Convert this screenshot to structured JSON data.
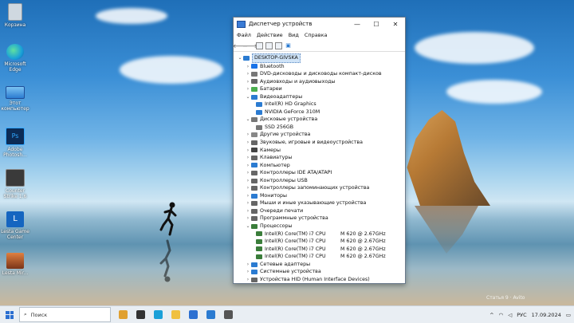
{
  "desktop": {
    "icons": [
      {
        "label": "Корзина",
        "icon": "recycle-bin-icon",
        "color": "#cfd8e0"
      },
      {
        "label": "Microsoft Edge",
        "icon": "edge-icon",
        "color": "#1aa0d8"
      },
      {
        "label": "Этот компьютер",
        "icon": "computer-icon",
        "color": "#4aa3e0"
      },
      {
        "label": "Adobe Photosh...",
        "icon": "photoshop-icon",
        "color": "#0c2b55"
      },
      {
        "label": "Counter Strike 1.6",
        "icon": "counter-strike-icon",
        "color": "#3a3a3a"
      },
      {
        "label": "Lesta Game Center",
        "icon": "lesta-icon",
        "color": "#1565c0"
      },
      {
        "label": "Lesta Mir...",
        "icon": "game-icon",
        "color": "#b5532a"
      }
    ]
  },
  "window": {
    "title": "Диспетчер устройств",
    "controls": {
      "minimize": "—",
      "maximize": "☐",
      "close": "✕"
    },
    "menu": [
      "Файл",
      "Действие",
      "Вид",
      "Справка"
    ],
    "root": "DESKTOP-GIVSKA",
    "tree": [
      {
        "label": "Bluetooth",
        "expanded": false,
        "color": "#1a73e8"
      },
      {
        "label": "DVD-дисководы и дисководы компакт-дисков",
        "expanded": false,
        "color": "#777"
      },
      {
        "label": "Аудиовходы и аудиовыходы",
        "expanded": false,
        "color": "#666"
      },
      {
        "label": "Батареи",
        "expanded": false,
        "color": "#4caf50"
      },
      {
        "label": "Видеоадаптеры",
        "expanded": true,
        "color": "#2b7bd1",
        "children": [
          "Intel(R) HD Graphics",
          "NVIDIA GeForce 310M"
        ]
      },
      {
        "label": "Дисковые устройства",
        "expanded": true,
        "color": "#777",
        "children": [
          "SSD 256GB"
        ]
      },
      {
        "label": "Другие устройства",
        "expanded": false,
        "color": "#888"
      },
      {
        "label": "Звуковые, игровые и видеоустройства",
        "expanded": false,
        "color": "#666"
      },
      {
        "label": "Камеры",
        "expanded": false,
        "color": "#444"
      },
      {
        "label": "Клавиатуры",
        "expanded": false,
        "color": "#666"
      },
      {
        "label": "Компьютер",
        "expanded": false,
        "color": "#2b7bd1"
      },
      {
        "label": "Контроллеры IDE ATA/ATAPI",
        "expanded": false,
        "color": "#666"
      },
      {
        "label": "Контроллеры USB",
        "expanded": false,
        "color": "#666"
      },
      {
        "label": "Контроллеры запоминающих устройства",
        "expanded": false,
        "color": "#666"
      },
      {
        "label": "Мониторы",
        "expanded": false,
        "color": "#2b7bd1"
      },
      {
        "label": "Мыши и иные указывающие устройства",
        "expanded": false,
        "color": "#666"
      },
      {
        "label": "Очереди печати",
        "expanded": false,
        "color": "#666"
      },
      {
        "label": "Программные устройства",
        "expanded": false,
        "color": "#666"
      },
      {
        "label": "Процессоры",
        "expanded": true,
        "color": "#3a7d3a",
        "children": [
          {
            "name": "Intel(R) Core(TM) i7 CPU",
            "speed": "M 620 @ 2.67GHz"
          },
          {
            "name": "Intel(R) Core(TM) i7 CPU",
            "speed": "M 620 @ 2.67GHz"
          },
          {
            "name": "Intel(R) Core(TM) i7 CPU",
            "speed": "M 620 @ 2.67GHz"
          },
          {
            "name": "Intel(R) Core(TM) i7 CPU",
            "speed": "M 620 @ 2.67GHz"
          }
        ]
      },
      {
        "label": "Сетевые адаптеры",
        "expanded": false,
        "color": "#2b7bd1"
      },
      {
        "label": "Системные устройства",
        "expanded": false,
        "color": "#2b7bd1"
      },
      {
        "label": "Устройства HID (Human Interface Devices)",
        "expanded": false,
        "color": "#666"
      }
    ]
  },
  "taskbar": {
    "search_placeholder": "Поиск",
    "apps": [
      {
        "icon": "news-widget-icon",
        "color": "#e0a030"
      },
      {
        "icon": "task-view-icon",
        "color": "#333"
      },
      {
        "icon": "edge-icon",
        "color": "#1aa0d8"
      },
      {
        "icon": "explorer-icon",
        "color": "#f0c040"
      },
      {
        "icon": "store-icon",
        "color": "#2b6fd1"
      },
      {
        "icon": "mail-icon",
        "color": "#2b7bd1"
      },
      {
        "icon": "device-manager-icon",
        "color": "#555"
      }
    ],
    "tray": {
      "chevron": "^",
      "lang": "РУС",
      "time": "",
      "date": "17.09.2024"
    }
  },
  "watermark": "Статья 9 · Avito"
}
